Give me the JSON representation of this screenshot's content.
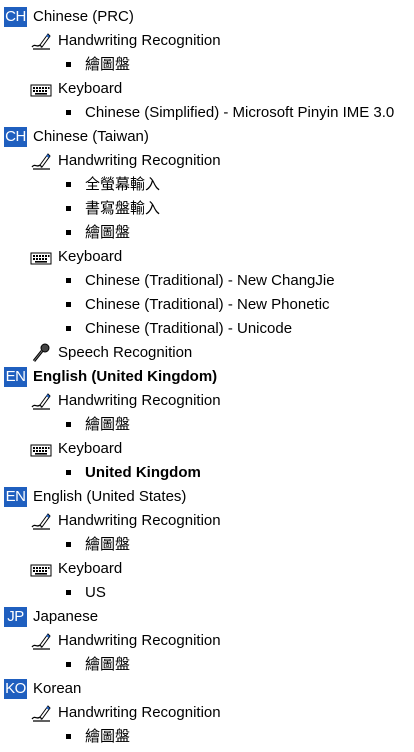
{
  "groups": [
    {
      "code": "CH",
      "name": "Chinese (PRC)",
      "bold": false,
      "services": [
        {
          "type": "handwriting",
          "icon": "handwriting-pen-icon",
          "label": "Handwriting Recognition",
          "items": [
            {
              "label": "繪圖盤",
              "bold": false
            }
          ]
        },
        {
          "type": "keyboard",
          "icon": "keyboard-icon",
          "label": "Keyboard",
          "items": [
            {
              "label": "Chinese (Simplified) - Microsoft Pinyin IME 3.0",
              "bold": false
            }
          ]
        }
      ]
    },
    {
      "code": "CH",
      "name": "Chinese (Taiwan)",
      "bold": false,
      "services": [
        {
          "type": "handwriting",
          "icon": "handwriting-pen-icon",
          "label": "Handwriting Recognition",
          "items": [
            {
              "label": "全螢幕輸入",
              "bold": false
            },
            {
              "label": "書寫盤輸入",
              "bold": false
            },
            {
              "label": "繪圖盤",
              "bold": false
            }
          ]
        },
        {
          "type": "keyboard",
          "icon": "keyboard-icon",
          "label": "Keyboard",
          "items": [
            {
              "label": "Chinese (Traditional) - New ChangJie",
              "bold": false
            },
            {
              "label": "Chinese (Traditional) - New Phonetic",
              "bold": false
            },
            {
              "label": "Chinese (Traditional) - Unicode",
              "bold": false
            }
          ]
        },
        {
          "type": "speech",
          "icon": "microphone-icon",
          "label": "Speech Recognition",
          "items": []
        }
      ]
    },
    {
      "code": "EN",
      "name": "English (United Kingdom)",
      "bold": true,
      "services": [
        {
          "type": "handwriting",
          "icon": "handwriting-pen-icon",
          "label": "Handwriting Recognition",
          "items": [
            {
              "label": "繪圖盤",
              "bold": false
            }
          ]
        },
        {
          "type": "keyboard",
          "icon": "keyboard-icon",
          "label": "Keyboard",
          "items": [
            {
              "label": "United Kingdom",
              "bold": true
            }
          ]
        }
      ]
    },
    {
      "code": "EN",
      "name": "English (United States)",
      "bold": false,
      "services": [
        {
          "type": "handwriting",
          "icon": "handwriting-pen-icon",
          "label": "Handwriting Recognition",
          "items": [
            {
              "label": "繪圖盤",
              "bold": false
            }
          ]
        },
        {
          "type": "keyboard",
          "icon": "keyboard-icon",
          "label": "Keyboard",
          "items": [
            {
              "label": "US",
              "bold": false
            }
          ]
        }
      ]
    },
    {
      "code": "JP",
      "name": "Japanese",
      "bold": false,
      "services": [
        {
          "type": "handwriting",
          "icon": "handwriting-pen-icon",
          "label": "Handwriting Recognition",
          "items": [
            {
              "label": "繪圖盤",
              "bold": false
            }
          ]
        }
      ]
    },
    {
      "code": "KO",
      "name": "Korean",
      "bold": false,
      "services": [
        {
          "type": "handwriting",
          "icon": "handwriting-pen-icon",
          "label": "Handwriting Recognition",
          "items": [
            {
              "label": "繪圖盤",
              "bold": false
            }
          ]
        }
      ]
    }
  ],
  "colors": {
    "badge_bg": "#1f5fbf",
    "badge_fg": "#ffffff"
  }
}
